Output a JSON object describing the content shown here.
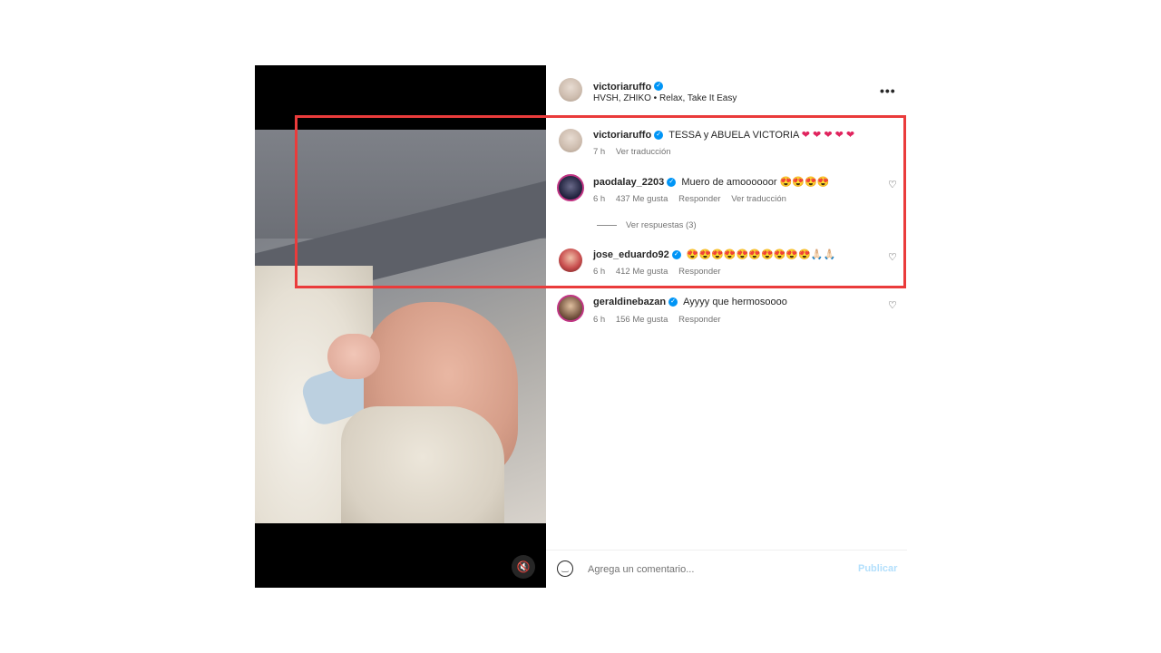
{
  "post": {
    "author": "victoriaruffo",
    "audio": "HVSH, ZHIKO • Relax, Take It Easy",
    "more_icon": "more-horizontal-icon",
    "media": {
      "mute_icon": "speaker-muted-icon"
    }
  },
  "comments": [
    {
      "user": "victoriaruffo",
      "text": "TESSA y ABUELA VICTORIA",
      "emoji": "❤ ❤ ❤ ❤ ❤",
      "time": "7 h",
      "likes": "",
      "reply": "",
      "translate": "Ver traducción"
    },
    {
      "user": "paodalay_2203",
      "text": "Muero de amoooooor",
      "emoji": "😍😍😍😍",
      "time": "6 h",
      "likes": "437 Me gusta",
      "reply": "Responder",
      "translate": "Ver traducción",
      "view_replies": "Ver respuestas (3)"
    },
    {
      "user": "jose_eduardo92",
      "text": "",
      "emoji": "😍😍😍😍😍😍😍😍😍😍🙏🏻🙏🏻",
      "time": "6 h",
      "likes": "412 Me gusta",
      "reply": "Responder"
    },
    {
      "user": "geraldinebazan",
      "text": "Ayyyy que hermosoooo",
      "emoji": "",
      "time": "6 h",
      "likes": "156 Me gusta",
      "reply": "Responder"
    }
  ],
  "footer": {
    "placeholder": "Agrega un comentario...",
    "publish": "Publicar",
    "emoji_icon": "smiley-icon"
  },
  "colors": {
    "highlight": "#ea3b3b",
    "verified": "#0095f6",
    "publish": "#b2dffc"
  }
}
